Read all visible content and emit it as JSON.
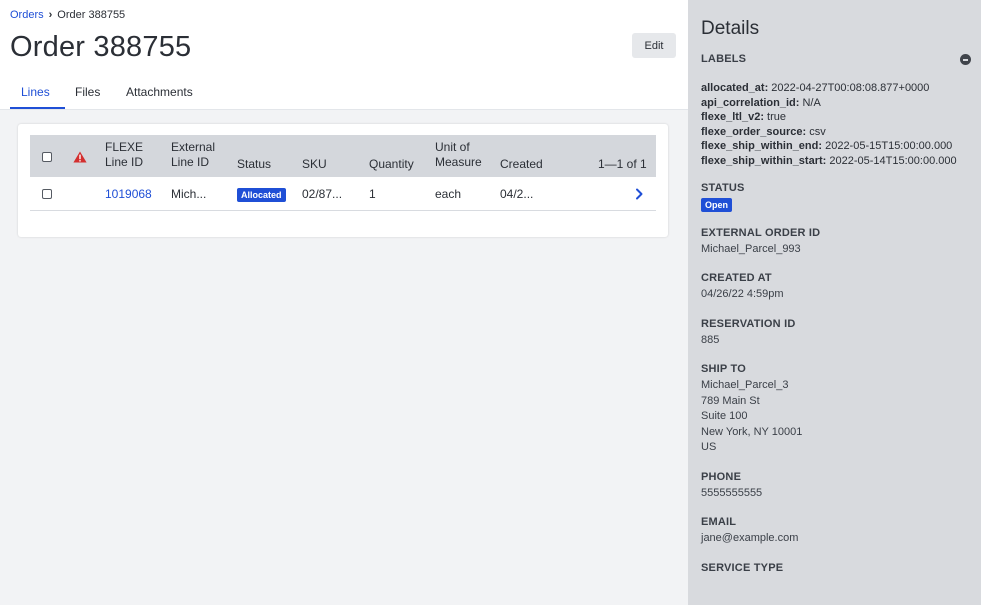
{
  "breadcrumb": {
    "parent": "Orders",
    "separator": "›",
    "current": "Order 388755"
  },
  "page": {
    "title": "Order 388755",
    "edit_label": "Edit"
  },
  "tabs": [
    {
      "label": "Lines"
    },
    {
      "label": "Files"
    },
    {
      "label": "Attachments"
    }
  ],
  "table": {
    "headers": {
      "flexe_line_id": [
        "FLEXE",
        "Line ID"
      ],
      "external_line_id": [
        "External",
        "Line ID"
      ],
      "status": "Status",
      "sku": "SKU",
      "quantity": "Quantity",
      "unit_of_measure": [
        "Unit of",
        "Measure"
      ],
      "created": "Created",
      "pagination": "1—1 of 1"
    },
    "rows": [
      {
        "flexe_line_id": "1019068",
        "external_line_id": "Mich...",
        "status": "Allocated",
        "sku": "02/87...",
        "quantity": "1",
        "unit_of_measure": "each",
        "created": "04/2..."
      }
    ]
  },
  "details": {
    "title": "Details",
    "labels_heading": "LABELS",
    "labels": [
      {
        "key": "allocated_at:",
        "value": " 2022-04-27T00:08:08.877+0000"
      },
      {
        "key": "api_correlation_id:",
        "value": " N/A"
      },
      {
        "key": "flexe_ltl_v2:",
        "value": " true"
      },
      {
        "key": "flexe_order_source:",
        "value": " csv"
      },
      {
        "key": "flexe_ship_within_end:",
        "value": " 2022-05-15T15:00:00.000"
      },
      {
        "key": "flexe_ship_within_start:",
        "value": " 2022-05-14T15:00:00.000"
      }
    ],
    "status_heading": "STATUS",
    "status_value": "Open",
    "external_order_id_heading": "EXTERNAL ORDER ID",
    "external_order_id": "Michael_Parcel_993",
    "created_at_heading": "CREATED AT",
    "created_at": "04/26/22 4:59pm",
    "reservation_id_heading": "RESERVATION ID",
    "reservation_id": "885",
    "ship_to_heading": "SHIP TO",
    "ship_to": [
      "Michael_Parcel_3",
      "789 Main St",
      "Suite 100",
      "New York, NY 10001",
      "US"
    ],
    "phone_heading": "PHONE",
    "phone": "5555555555",
    "email_heading": "EMAIL",
    "email": "jane@example.com",
    "service_type_heading": "SERVICE TYPE"
  },
  "colors": {
    "accent": "#1f4fd6",
    "warning": "#d32f2f",
    "panel_bg": "#d8dade",
    "table_header_bg": "#d4d7dc"
  },
  "icons": {
    "breadcrumb_separator": "chevron-right-icon",
    "warning": "warning-triangle-icon",
    "row_open": "chevron-right-icon",
    "collapse": "minus-circle-icon"
  }
}
